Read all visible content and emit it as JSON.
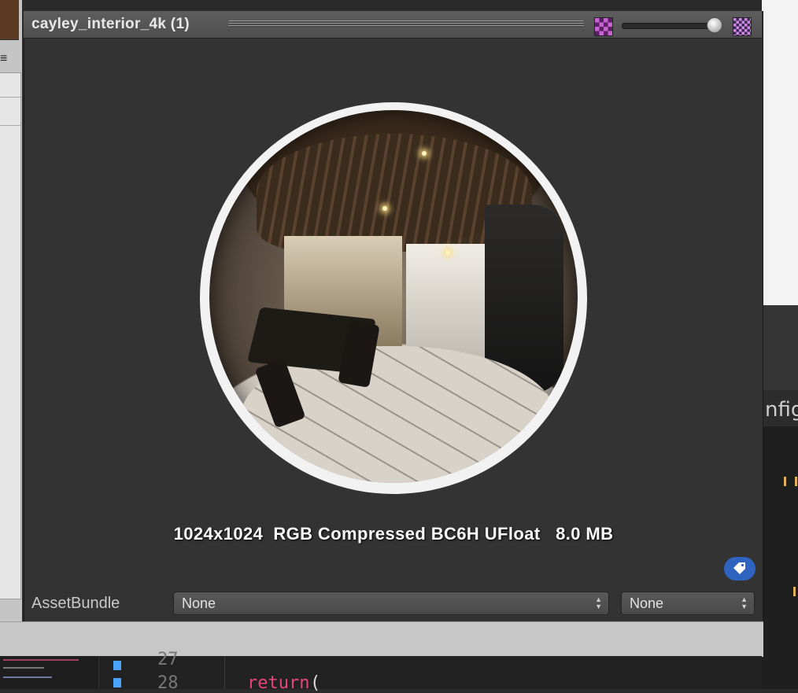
{
  "window": {
    "title": "cayley_interior_4k (1)",
    "icons": [
      "checker-small-icon",
      "checker-large-icon"
    ],
    "zoom_slider_value": 0.95
  },
  "preview": {
    "info_text": "1024x1024  RGB Compressed BC6H UFloat   8.0 MB"
  },
  "asset_bundle": {
    "label": "AssetBundle",
    "name_value": "None",
    "variant_value": "None"
  },
  "background": {
    "partial_text": "nfig.",
    "code_lines": [
      {
        "number": "27",
        "text": ""
      },
      {
        "number": "28",
        "keyword": "return",
        "rest": " ("
      }
    ]
  },
  "colors": {
    "panel_bg": "#333333",
    "tag_button": "#2f63c0",
    "code_keyword": "#e8457a"
  }
}
